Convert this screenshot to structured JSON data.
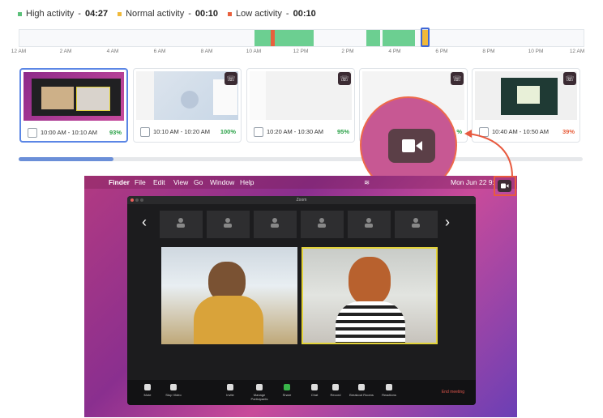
{
  "legend": {
    "items": [
      {
        "label": "High activity",
        "value": "04:27",
        "color": "#5cc07a"
      },
      {
        "label": "Normal activity",
        "value": "00:10",
        "color": "#f0b93a"
      },
      {
        "label": "Low activity",
        "value": "00:10",
        "color": "#e8603d"
      }
    ]
  },
  "timeline": {
    "ticks": [
      "12 AM",
      "2 AM",
      "4 AM",
      "6 AM",
      "8 AM",
      "10 AM",
      "12 PM",
      "2 PM",
      "4 PM",
      "6 PM",
      "8 PM",
      "10 PM",
      "12 AM"
    ]
  },
  "cards": [
    {
      "time": "10:00 AM - 10:10 AM",
      "pct": "93%",
      "pct_color": "#2aa147"
    },
    {
      "time": "10:10 AM - 10:20 AM",
      "pct": "100%",
      "pct_color": "#2aa147"
    },
    {
      "time": "10:20 AM - 10:30 AM",
      "pct": "95%",
      "pct_color": "#2aa147"
    },
    {
      "time": "",
      "pct": "%",
      "pct_color": "#2aa147"
    },
    {
      "time": "10:40 AM - 10:50 AM",
      "pct": "39%",
      "pct_color": "#e8603d"
    }
  ],
  "mac": {
    "menu": [
      "Finder",
      "File",
      "Edit",
      "View",
      "Go",
      "Window",
      "Help"
    ],
    "clock": "Mon Jun 22  9:"
  },
  "zoom": {
    "title": "Zoom",
    "toolbar": [
      "Mute",
      "Stop Video",
      "Invite",
      "Manage Participants",
      "Share",
      "Chat",
      "Record",
      "Breakout Rooms",
      "Reactions"
    ],
    "end": "End meeting"
  }
}
